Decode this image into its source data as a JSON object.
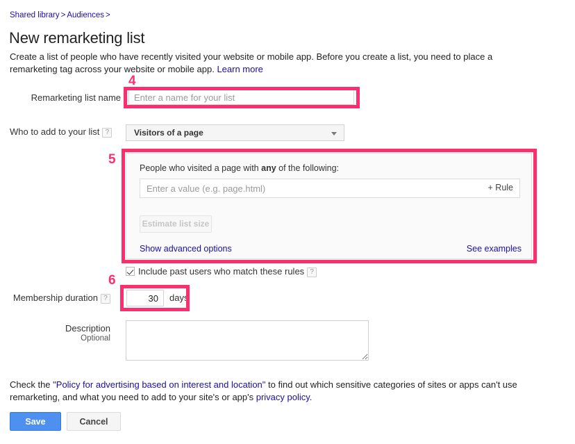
{
  "breadcrumb": {
    "items": [
      "Shared library",
      "Audiences"
    ],
    "separator": ">",
    "trailing_separator": ">"
  },
  "page": {
    "title": "New remarketing list",
    "intro_text": "Create a list of people who have recently visited your website or mobile app. Before you create a list, you need to place a remarketing tag across your website or mobile app.",
    "intro_link": "Learn more"
  },
  "form": {
    "name_label": "Remarketing list name",
    "name_placeholder": "Enter a name for your list",
    "name_value": "",
    "who_label": "Who to add to your list",
    "who_help": "?",
    "who_selected": "Visitors of a page",
    "rules": {
      "title_prefix": "People who visited a page with ",
      "title_bold": "any",
      "title_suffix": " of the following:",
      "value_placeholder": "Enter a value (e.g. page.html)",
      "value_value": "",
      "add_rule_label": "+ Rule",
      "estimate_label": "Estimate list size",
      "advanced_link": "Show advanced options",
      "examples_link": "See examples"
    },
    "include_past_label": "Include past users who match these rules",
    "include_past_help": "?",
    "include_past_checked": true,
    "duration_label": "Membership duration",
    "duration_help": "?",
    "duration_value": "30",
    "duration_unit": "days",
    "description_label": "Description",
    "description_sublabel": "Optional",
    "description_value": ""
  },
  "policy": {
    "prefix": "Check the ",
    "link1": "\"Policy for advertising based on interest and location\"",
    "middle": " to find out which sensitive categories of sites or apps can't use remarketing, and what you need to add to your site's or app's ",
    "link2": "privacy policy",
    "suffix": "."
  },
  "actions": {
    "save_label": "Save",
    "cancel_label": "Cancel"
  },
  "annotations": {
    "color": "#fb2e6e",
    "markers": [
      {
        "number": "4",
        "target": "remarketing-list-name-field"
      },
      {
        "number": "5",
        "target": "rules-panel"
      },
      {
        "number": "6",
        "target": "membership-duration-field"
      }
    ]
  },
  "colors": {
    "link": "#1a0dab",
    "save_button": "#4d90f0",
    "annotation_pink": "#fb2e6e"
  }
}
